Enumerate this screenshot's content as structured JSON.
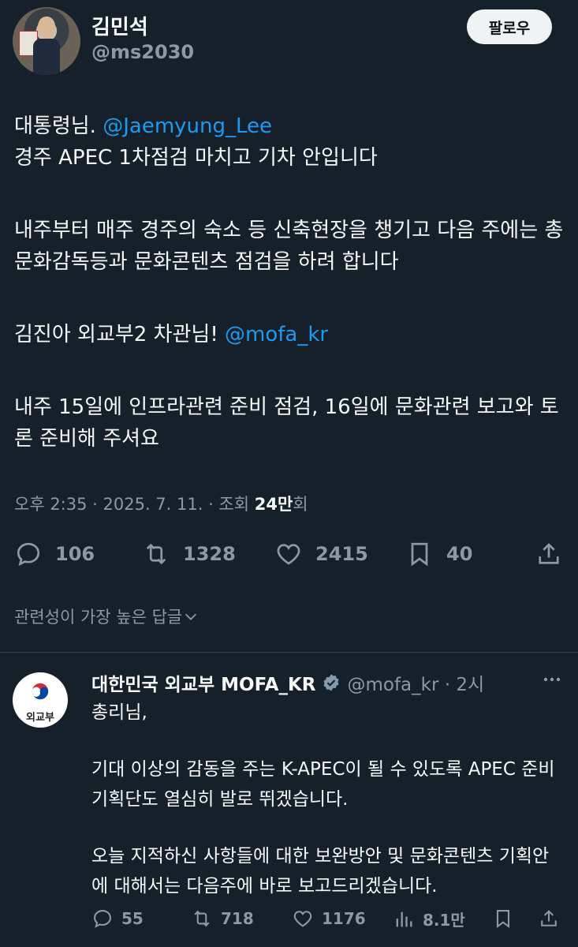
{
  "author": {
    "name": "김민석",
    "handle": "@ms2030",
    "follow_label": "팔로우"
  },
  "tweet": {
    "line1_prefix": "대통령님. ",
    "line1_mention": "@Jaemyung_Lee",
    "line2": "경주 APEC 1차점검 마치고 기차 안입니다",
    "para2": "내주부터 매주 경주의 숙소 등 신축현장을 챙기고 다음 주에는 총문화감독등과 문화콘텐츠 점검을 하려 합니다",
    "para3_prefix": "김진아 외교부2 차관님! ",
    "para3_mention": "@mofa_kr",
    "para4": "내주 15일에 인프라관련 준비 점검, 16일에 문화관련 보고와 토론 준비해 주셔요"
  },
  "meta": {
    "timestamp": "오후 2:35 · 2025. 7. 11. · 조회 ",
    "views": "24만",
    "views_suffix": "회"
  },
  "actions": {
    "replies": "106",
    "retweets": "1328",
    "likes": "2415",
    "bookmarks": "40"
  },
  "sort_label": "관련성이 가장 높은 답글",
  "reply": {
    "avatar_label": "외교부",
    "name": "대한민국 외교부 MOFA_KR",
    "handle": "@mofa_kr · 2시",
    "line1": "총리님,",
    "para2": "기대 이상의 감동을 주는 K-APEC이 될 수 있도록 APEC 준비기획단도 열심히 발로 뛰겠습니다.",
    "para3": "오늘 지적하신 사항들에 대한 보완방안 및 문화콘텐츠 기획안에 대해서는 다음주에 바로 보고드리겠습니다.",
    "actions": {
      "replies": "55",
      "retweets": "718",
      "likes": "1176",
      "views": "8.1만"
    }
  },
  "colors": {
    "background": "#15202b",
    "mention": "#1d9bf0",
    "muted": "#8b98a5",
    "verified": "#829aab"
  }
}
